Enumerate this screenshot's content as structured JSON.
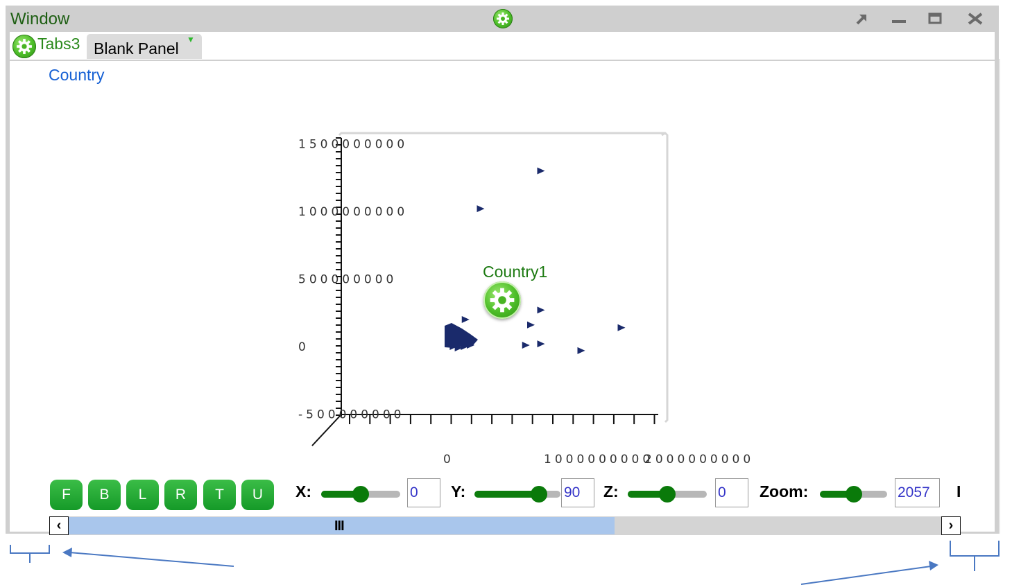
{
  "window": {
    "title": "Window"
  },
  "tabs": [
    {
      "label": "Tabs3"
    },
    {
      "label": "Blank Panel",
      "arrow": "▼"
    }
  ],
  "panel": {
    "title": "Country"
  },
  "chart_data": {
    "type": "scatter",
    "title": "",
    "xlabel": "",
    "ylabel": "",
    "y_ticks": [
      "1500000000",
      "1000000000",
      "500000000",
      "0",
      "-500000000"
    ],
    "x_ticks": [
      "0",
      "1000000000",
      "2000000000"
    ],
    "ylim": [
      -500000000,
      1500000000
    ],
    "xlim": [
      -1000000000,
      2000000000
    ],
    "marker": "triangle-right",
    "marker_color": "#1a2a6b",
    "series": [
      {
        "points": [
          [
            900000000,
            1300000000
          ],
          [
            300000000,
            1020000000
          ],
          [
            900000000,
            270000000
          ],
          [
            800000000,
            160000000
          ],
          [
            1700000000,
            140000000
          ],
          [
            750000000,
            10000000
          ],
          [
            900000000,
            20000000
          ],
          [
            1300000000,
            -30000000
          ],
          [
            150000000,
            200000000
          ],
          [
            100000000,
            120000000
          ],
          [
            60000000,
            80000000
          ],
          [
            20000000,
            30000000
          ],
          [
            60000000,
            20000000
          ],
          [
            120000000,
            50000000
          ],
          [
            200000000,
            10000000
          ],
          [
            30000000,
            0
          ],
          [
            80000000,
            -10000000
          ],
          [
            140000000,
            0
          ]
        ]
      }
    ],
    "grid": false
  },
  "annotation": {
    "label": "Country1"
  },
  "controls": {
    "view_buttons": [
      "F",
      "B",
      "L",
      "R",
      "T",
      "U"
    ],
    "x": {
      "label": "X:",
      "value": "0",
      "level": 0.5
    },
    "y": {
      "label": "Y:",
      "value": "90",
      "level": 0.75
    },
    "z": {
      "label": "Z:",
      "value": "0",
      "level": 0.5
    },
    "zoom": {
      "label": "Zoom:",
      "value": "2057",
      "level": 0.5
    },
    "truncated_label": "I"
  },
  "scrollbar": {
    "left_icon": "‹",
    "right_icon": "›",
    "grip": "III",
    "thumb_fraction": 0.6
  },
  "icons": [
    "gear-icon",
    "popout-icon",
    "minimize-icon",
    "maximize-icon",
    "close-icon",
    "chevron-left-icon",
    "chevron-right-icon"
  ],
  "colors": {
    "title_green": "#1d5e12",
    "tab_green": "#2b8a1c",
    "link_blue": "#1560d4",
    "button_green": "#2aa83a",
    "marker": "#1a2a6b"
  }
}
